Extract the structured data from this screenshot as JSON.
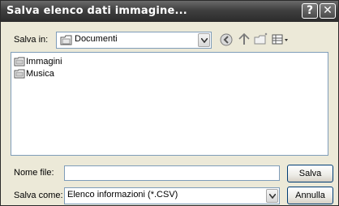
{
  "window": {
    "title": "Salva elenco dati immagine..."
  },
  "titlebar": {
    "help_glyph": "?",
    "close_glyph": "✕"
  },
  "location": {
    "label": "Salva in:",
    "current_folder": "Documenti",
    "folder_icon": "folder-documents-icon"
  },
  "toolbar": {
    "icons": [
      "back-icon",
      "up-folder-icon",
      "new-folder-icon",
      "views-menu-icon"
    ]
  },
  "files": [
    {
      "name": "Immagini",
      "icon": "folder-icon"
    },
    {
      "name": "Musica",
      "icon": "folder-icon"
    }
  ],
  "filename": {
    "label": "Nome file:",
    "value": ""
  },
  "filetype": {
    "label": "Salva come:",
    "value": "Elenco informazioni (*.CSV)"
  },
  "buttons": {
    "save": "Salva",
    "cancel": "Annulla"
  },
  "colors": {
    "titlebar": "#3f3f3f",
    "dialog_bg": "#ece9d8",
    "field_border": "#7f9db9",
    "button_border": "#003c74"
  }
}
